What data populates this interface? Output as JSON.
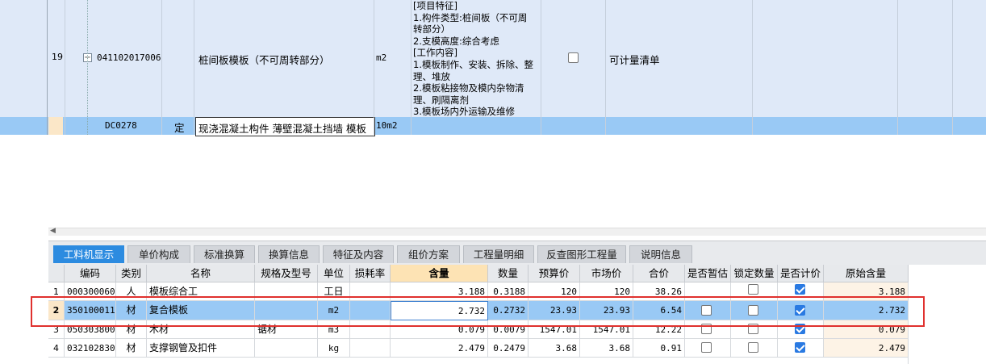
{
  "top_grid": {
    "row19": {
      "index": "19",
      "code": "041102017006",
      "name": "桩间板模板（不可周转部分）",
      "unit": "m2",
      "features": "[项目特征]\n1.构件类型:桩间板（不可周\n转部分）\n2.支模高度:综合考虑\n[工作内容]\n1.模板制作、安装、拆除、整\n理、堆放\n2.模板粘接物及模内杂物清\n理、刷隔离剂\n3.模板场内外运输及维修",
      "checked": false,
      "measure_type": "可计量清单"
    },
    "sub_row": {
      "code": "DC0278",
      "type": "定",
      "name": "现浇混凝土构件 薄壁混凝土挡墙 模板",
      "unit": "10m2"
    },
    "tree_toggle": "−"
  },
  "tabs": [
    {
      "label": "工料机显示",
      "active": true
    },
    {
      "label": "单价构成",
      "active": false
    },
    {
      "label": "标准换算",
      "active": false
    },
    {
      "label": "换算信息",
      "active": false
    },
    {
      "label": "特征及内容",
      "active": false
    },
    {
      "label": "组价方案",
      "active": false
    },
    {
      "label": "工程量明细",
      "active": false
    },
    {
      "label": "反查图形工程量",
      "active": false
    },
    {
      "label": "说明信息",
      "active": false
    }
  ],
  "table": {
    "headers": [
      "编码",
      "类别",
      "名称",
      "规格及型号",
      "单位",
      "损耗率",
      "含量",
      "数量",
      "预算价",
      "市场价",
      "合价",
      "是否暂估",
      "锁定数量",
      "是否计价",
      "原始含量"
    ],
    "rows": [
      {
        "n": "1",
        "code": "000300060",
        "cat": "人",
        "name": "模板综合工",
        "spec": "",
        "unit": "工日",
        "loss": "",
        "qty": "3.188",
        "amount": "0.3188",
        "budget": "120",
        "market": "120",
        "total": "38.26",
        "temp": null,
        "lock": false,
        "priced": true,
        "orig": "3.188"
      },
      {
        "n": "2",
        "code": "350100011",
        "cat": "材",
        "name": "复合模板",
        "spec": "",
        "unit": "m2",
        "loss": "",
        "qty": "2.732",
        "amount": "0.2732",
        "budget": "23.93",
        "market": "23.93",
        "total": "6.54",
        "temp": false,
        "lock": false,
        "priced": true,
        "orig": "2.732"
      },
      {
        "n": "3",
        "code": "050303800",
        "cat": "材",
        "name": "木材",
        "spec": "锯材",
        "unit": "m3",
        "loss": "",
        "qty": "0.079",
        "amount": "0.0079",
        "budget": "1547.01",
        "market": "1547.01",
        "total": "12.22",
        "temp": false,
        "lock": false,
        "priced": true,
        "orig": "0.079"
      },
      {
        "n": "4",
        "code": "032102830",
        "cat": "材",
        "name": "支撑钢管及扣件",
        "spec": "",
        "unit": "kg",
        "loss": "",
        "qty": "2.479",
        "amount": "0.2479",
        "budget": "3.68",
        "market": "3.68",
        "total": "0.91",
        "temp": false,
        "lock": false,
        "priced": true,
        "orig": "2.479"
      }
    ]
  },
  "colors": {
    "selected_row": "#99c9f5",
    "active_tab": "#2c8be0",
    "highlight_header": "#fde3b4",
    "annotation_box": "#e0312e"
  }
}
